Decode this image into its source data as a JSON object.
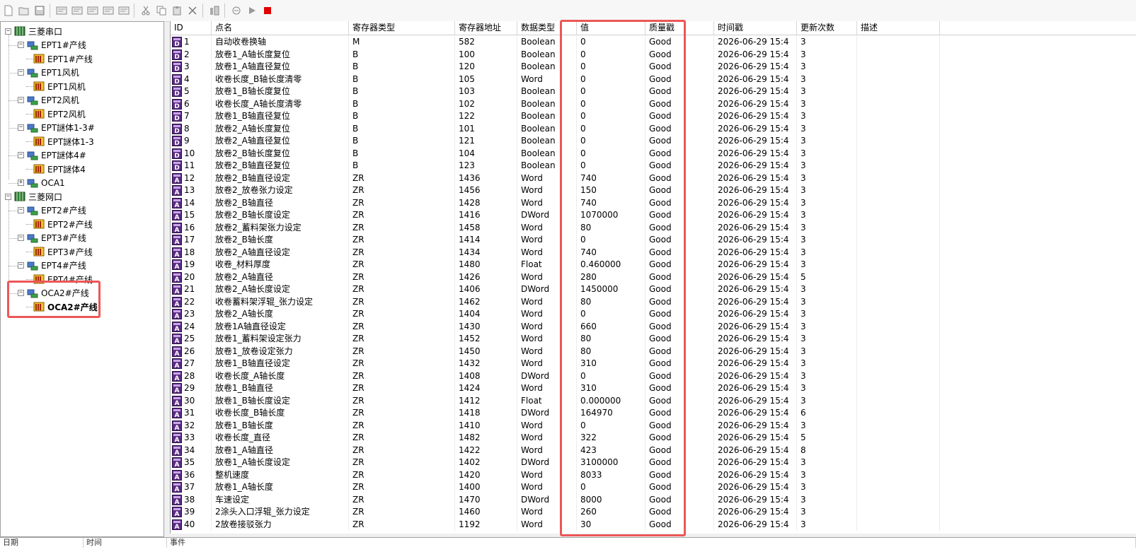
{
  "toolbar": {
    "buttons": [
      {
        "name": "new-icon"
      },
      {
        "name": "open-icon"
      },
      {
        "name": "save-icon"
      },
      {
        "name": "sep"
      },
      {
        "name": "add-device-icon"
      },
      {
        "name": "add-group-icon"
      },
      {
        "name": "add-tag-icon"
      },
      {
        "name": "edit-icon"
      },
      {
        "name": "properties-icon"
      },
      {
        "name": "sep"
      },
      {
        "name": "cut-icon"
      },
      {
        "name": "copy-icon"
      },
      {
        "name": "paste-icon"
      },
      {
        "name": "delete-icon"
      },
      {
        "name": "sep"
      },
      {
        "name": "tool-icon"
      },
      {
        "name": "sep"
      },
      {
        "name": "monitor-icon"
      },
      {
        "name": "start-icon"
      },
      {
        "name": "stop-icon"
      }
    ],
    "stop_color": "#e00000"
  },
  "tree": [
    {
      "label": "三菱串口",
      "level": 0,
      "type": "channel",
      "expanded": true
    },
    {
      "label": "EPT1#产线",
      "level": 1,
      "type": "device",
      "expanded": true
    },
    {
      "label": "EPT1#产线",
      "level": 2,
      "type": "group"
    },
    {
      "label": "EPT1风机",
      "level": 1,
      "type": "device",
      "expanded": true
    },
    {
      "label": "EPT1风机",
      "level": 2,
      "type": "group"
    },
    {
      "label": "EPT2风机",
      "level": 1,
      "type": "device",
      "expanded": true
    },
    {
      "label": "EPT2风机",
      "level": 2,
      "type": "group"
    },
    {
      "label": "EPT謎体1-3#",
      "level": 1,
      "type": "device",
      "expanded": true
    },
    {
      "label": "EPT謎体1-3",
      "level": 2,
      "type": "group"
    },
    {
      "label": "EPT謎体4#",
      "level": 1,
      "type": "device",
      "expanded": true
    },
    {
      "label": "EPT謎体4",
      "level": 2,
      "type": "group"
    },
    {
      "label": "OCA1",
      "level": 1,
      "type": "device",
      "expanded": false
    },
    {
      "label": "三菱网口",
      "level": 0,
      "type": "channel",
      "expanded": true
    },
    {
      "label": "EPT2#产线",
      "level": 1,
      "type": "device",
      "expanded": true
    },
    {
      "label": "EPT2#产线",
      "level": 2,
      "type": "group"
    },
    {
      "label": "EPT3#产线",
      "level": 1,
      "type": "device",
      "expanded": true
    },
    {
      "label": "EPT3#产线",
      "level": 2,
      "type": "group"
    },
    {
      "label": "EPT4#产线",
      "level": 1,
      "type": "device",
      "expanded": true
    },
    {
      "label": "EPT4#产线",
      "level": 2,
      "type": "group"
    },
    {
      "label": "OCA2#产线",
      "level": 1,
      "type": "device",
      "expanded": true
    },
    {
      "label": "OCA2#产线",
      "level": 2,
      "type": "group",
      "selected": true
    }
  ],
  "grid": {
    "columns": [
      "ID",
      "点名",
      "寄存器类型",
      "寄存器地址",
      "数据类型",
      "",
      "值",
      "质量戳",
      "时间戳",
      "更新次数",
      "描述"
    ],
    "timestamp_display": "2026-06-29 15:4",
    "rows": [
      {
        "id": "1",
        "name": "自动收卷换轴",
        "reg": "M",
        "addr": "582",
        "dtype": "Boolean",
        "value": "0",
        "quality": "Good",
        "count": "3",
        "icon": "D"
      },
      {
        "id": "2",
        "name": "放卷1_A轴长度复位",
        "reg": "B",
        "addr": "100",
        "dtype": "Boolean",
        "value": "0",
        "quality": "Good",
        "count": "3",
        "icon": "D"
      },
      {
        "id": "3",
        "name": "放卷1_A轴直径复位",
        "reg": "B",
        "addr": "120",
        "dtype": "Boolean",
        "value": "0",
        "quality": "Good",
        "count": "3",
        "icon": "D"
      },
      {
        "id": "4",
        "name": "收卷长度_B轴长度清零",
        "reg": "B",
        "addr": "105",
        "dtype": "Word",
        "value": "0",
        "quality": "Good",
        "count": "3",
        "icon": "D"
      },
      {
        "id": "5",
        "name": "放卷1_B轴长度复位",
        "reg": "B",
        "addr": "103",
        "dtype": "Boolean",
        "value": "0",
        "quality": "Good",
        "count": "3",
        "icon": "D"
      },
      {
        "id": "6",
        "name": "收卷长度_A轴长度清零",
        "reg": "B",
        "addr": "102",
        "dtype": "Boolean",
        "value": "0",
        "quality": "Good",
        "count": "3",
        "icon": "D"
      },
      {
        "id": "7",
        "name": "放卷1_B轴直径复位",
        "reg": "B",
        "addr": "122",
        "dtype": "Boolean",
        "value": "0",
        "quality": "Good",
        "count": "3",
        "icon": "D"
      },
      {
        "id": "8",
        "name": "放卷2_A轴长度复位",
        "reg": "B",
        "addr": "101",
        "dtype": "Boolean",
        "value": "0",
        "quality": "Good",
        "count": "3",
        "icon": "D"
      },
      {
        "id": "9",
        "name": "放卷2_A轴直径复位",
        "reg": "B",
        "addr": "121",
        "dtype": "Boolean",
        "value": "0",
        "quality": "Good",
        "count": "3",
        "icon": "D"
      },
      {
        "id": "10",
        "name": "放卷2_B轴长度复位",
        "reg": "B",
        "addr": "104",
        "dtype": "Boolean",
        "value": "0",
        "quality": "Good",
        "count": "3",
        "icon": "D"
      },
      {
        "id": "11",
        "name": "放卷2_B轴直径复位",
        "reg": "B",
        "addr": "123",
        "dtype": "Boolean",
        "value": "0",
        "quality": "Good",
        "count": "3",
        "icon": "D"
      },
      {
        "id": "12",
        "name": "放卷2_B轴直径设定",
        "reg": "ZR",
        "addr": "1436",
        "dtype": "Word",
        "value": "740",
        "quality": "Good",
        "count": "3",
        "icon": "A"
      },
      {
        "id": "13",
        "name": "放卷2_放卷张力设定",
        "reg": "ZR",
        "addr": "1456",
        "dtype": "Word",
        "value": "150",
        "quality": "Good",
        "count": "3",
        "icon": "A"
      },
      {
        "id": "14",
        "name": "放卷2_B轴直径",
        "reg": "ZR",
        "addr": "1428",
        "dtype": "Word",
        "value": "740",
        "quality": "Good",
        "count": "3",
        "icon": "A"
      },
      {
        "id": "15",
        "name": "放卷2_B轴长度设定",
        "reg": "ZR",
        "addr": "1416",
        "dtype": "DWord",
        "value": "1070000",
        "quality": "Good",
        "count": "3",
        "icon": "A"
      },
      {
        "id": "16",
        "name": "放卷2_蓄料架张力设定",
        "reg": "ZR",
        "addr": "1458",
        "dtype": "Word",
        "value": "80",
        "quality": "Good",
        "count": "3",
        "icon": "A"
      },
      {
        "id": "17",
        "name": "放卷2_B轴长度",
        "reg": "ZR",
        "addr": "1414",
        "dtype": "Word",
        "value": "0",
        "quality": "Good",
        "count": "3",
        "icon": "A"
      },
      {
        "id": "18",
        "name": "放卷2_A轴直径设定",
        "reg": "ZR",
        "addr": "1434",
        "dtype": "Word",
        "value": "740",
        "quality": "Good",
        "count": "3",
        "icon": "A"
      },
      {
        "id": "19",
        "name": "收卷_材料厚度",
        "reg": "ZR",
        "addr": "1480",
        "dtype": "Float",
        "value": "0.460000",
        "quality": "Good",
        "count": "3",
        "icon": "A"
      },
      {
        "id": "20",
        "name": "放卷2_A轴直径",
        "reg": "ZR",
        "addr": "1426",
        "dtype": "Word",
        "value": "280",
        "quality": "Good",
        "count": "5",
        "icon": "A"
      },
      {
        "id": "21",
        "name": "放卷2_A轴长度设定",
        "reg": "ZR",
        "addr": "1406",
        "dtype": "DWord",
        "value": "1450000",
        "quality": "Good",
        "count": "3",
        "icon": "A"
      },
      {
        "id": "22",
        "name": "收卷蓄料架浮辊_张力设定",
        "reg": "ZR",
        "addr": "1462",
        "dtype": "Word",
        "value": "80",
        "quality": "Good",
        "count": "3",
        "icon": "A"
      },
      {
        "id": "23",
        "name": "放卷2_A轴长度",
        "reg": "ZR",
        "addr": "1404",
        "dtype": "Word",
        "value": "0",
        "quality": "Good",
        "count": "3",
        "icon": "A"
      },
      {
        "id": "24",
        "name": "放卷1A轴直径设定",
        "reg": "ZR",
        "addr": "1430",
        "dtype": "Word",
        "value": "660",
        "quality": "Good",
        "count": "3",
        "icon": "A"
      },
      {
        "id": "25",
        "name": "放卷1_蓄料架设定张力",
        "reg": "ZR",
        "addr": "1452",
        "dtype": "Word",
        "value": "80",
        "quality": "Good",
        "count": "3",
        "icon": "A"
      },
      {
        "id": "26",
        "name": "放卷1_放卷设定张力",
        "reg": "ZR",
        "addr": "1450",
        "dtype": "Word",
        "value": "80",
        "quality": "Good",
        "count": "3",
        "icon": "A"
      },
      {
        "id": "27",
        "name": "放卷1_B轴直径设定",
        "reg": "ZR",
        "addr": "1432",
        "dtype": "Word",
        "value": "310",
        "quality": "Good",
        "count": "3",
        "icon": "A"
      },
      {
        "id": "28",
        "name": "收卷长度_A轴长度",
        "reg": "ZR",
        "addr": "1408",
        "dtype": "DWord",
        "value": "0",
        "quality": "Good",
        "count": "3",
        "icon": "A"
      },
      {
        "id": "29",
        "name": "放卷1_B轴直径",
        "reg": "ZR",
        "addr": "1424",
        "dtype": "Word",
        "value": "310",
        "quality": "Good",
        "count": "3",
        "icon": "A"
      },
      {
        "id": "30",
        "name": "放卷1_B轴长度设定",
        "reg": "ZR",
        "addr": "1412",
        "dtype": "Float",
        "value": "0.000000",
        "quality": "Good",
        "count": "3",
        "icon": "A"
      },
      {
        "id": "31",
        "name": "收卷长度_B轴长度",
        "reg": "ZR",
        "addr": "1418",
        "dtype": "DWord",
        "value": "164970",
        "quality": "Good",
        "count": "6",
        "icon": "A"
      },
      {
        "id": "32",
        "name": "放卷1_B轴长度",
        "reg": "ZR",
        "addr": "1410",
        "dtype": "Word",
        "value": "0",
        "quality": "Good",
        "count": "3",
        "icon": "A"
      },
      {
        "id": "33",
        "name": "收卷长度_直径",
        "reg": "ZR",
        "addr": "1482",
        "dtype": "Word",
        "value": "322",
        "quality": "Good",
        "count": "5",
        "icon": "A"
      },
      {
        "id": "34",
        "name": "放卷1_A轴直径",
        "reg": "ZR",
        "addr": "1422",
        "dtype": "Word",
        "value": "423",
        "quality": "Good",
        "count": "8",
        "icon": "A"
      },
      {
        "id": "35",
        "name": "放卷1_A轴长度设定",
        "reg": "ZR",
        "addr": "1402",
        "dtype": "DWord",
        "value": "3100000",
        "quality": "Good",
        "count": "3",
        "icon": "A"
      },
      {
        "id": "36",
        "name": "整机速度",
        "reg": "ZR",
        "addr": "1420",
        "dtype": "Word",
        "value": "8033",
        "quality": "Good",
        "count": "3",
        "icon": "A"
      },
      {
        "id": "37",
        "name": "放卷1_A轴长度",
        "reg": "ZR",
        "addr": "1400",
        "dtype": "Word",
        "value": "0",
        "quality": "Good",
        "count": "3",
        "icon": "A"
      },
      {
        "id": "38",
        "name": "车速设定",
        "reg": "ZR",
        "addr": "1470",
        "dtype": "DWord",
        "value": "8000",
        "quality": "Good",
        "count": "3",
        "icon": "A"
      },
      {
        "id": "39",
        "name": "2涂头入口浮辊_张力设定",
        "reg": "ZR",
        "addr": "1460",
        "dtype": "Word",
        "value": "260",
        "quality": "Good",
        "count": "3",
        "icon": "A"
      },
      {
        "id": "40",
        "name": "2放卷接驳张力",
        "reg": "ZR",
        "addr": "1192",
        "dtype": "Word",
        "value": "30",
        "quality": "Good",
        "count": "3",
        "icon": "A"
      }
    ]
  },
  "log": {
    "columns": [
      "日期",
      "时间",
      "事件"
    ]
  },
  "highlight_color": "#ec5757"
}
